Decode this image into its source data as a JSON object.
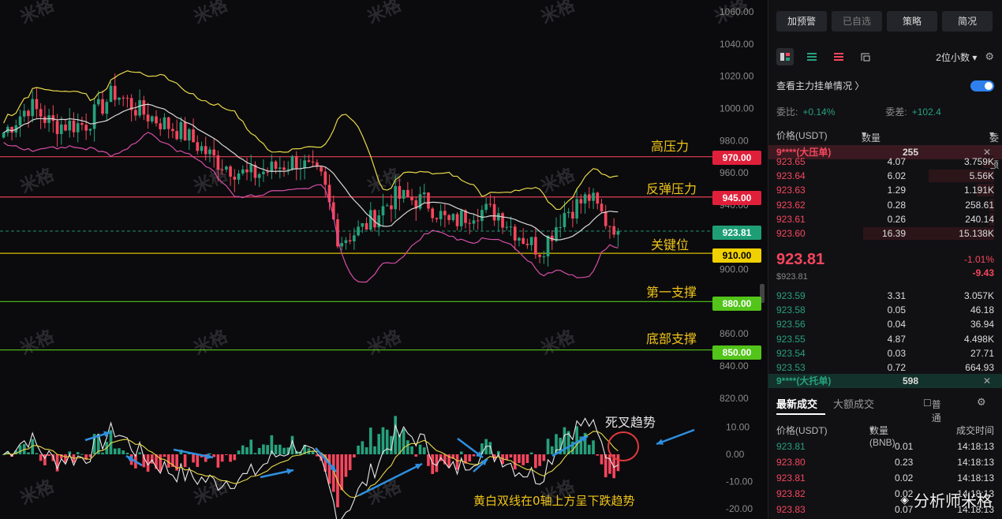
{
  "chart_data": [
    {
      "type": "candlestick",
      "pair": "BNB/USDT",
      "y_axis": {
        "ticks": [
          1060,
          1040,
          1020,
          1000,
          980,
          960,
          940,
          900,
          860,
          840,
          820
        ],
        "range": [
          820,
          1065
        ]
      },
      "current_price": 923.81,
      "overlays": [
        "bollinger-upper",
        "bollinger-middle",
        "bollinger-lower"
      ],
      "levels": [
        {
          "price": 970,
          "label": "970.00",
          "annotation": "高压力",
          "color": "#f6465d"
        },
        {
          "price": 945,
          "label": "945.00",
          "annotation": "反弹压力",
          "color": "#f6465d"
        },
        {
          "price": 923.81,
          "label": "923.81",
          "annotation": "关键位",
          "color": "#26a17b"
        },
        {
          "price": 910,
          "label": "910.00",
          "annotation": "",
          "color": "#f0d000"
        },
        {
          "price": 880,
          "label": "880.00",
          "annotation": "第一支撑",
          "color": "#52c41a"
        },
        {
          "price": 850,
          "label": "850.00",
          "annotation": "底部支撑",
          "color": "#52c41a"
        }
      ]
    },
    {
      "type": "macd",
      "y_axis": {
        "ticks": [
          10.0,
          0.0,
          -10.0,
          -20.0
        ],
        "labels": [
          "10.00",
          "0.00",
          "-10.00",
          "-20.00"
        ],
        "range": [
          -22,
          13
        ]
      },
      "annotations": [
        "死叉趋势",
        "黄白双线在0轴上方呈下跌趋势"
      ]
    }
  ],
  "watermark_text": "米格",
  "brand": "分析师米格",
  "panel": {
    "buttons": [
      "加预警",
      "已自选",
      "策略",
      "简况"
    ],
    "decimal_select": "2位小数",
    "main_orders_label": "查看主力挂单情况",
    "ratio_label": "委比:",
    "ratio_value": "+0.14%",
    "diff_label": "委差:",
    "diff_value": "+102.4",
    "col_price": "价格(USDT)",
    "col_qty": "数量 (BNB)",
    "col_total": "委托额",
    "ask_wall_name": "9****(大压单)",
    "ask_wall_qty": "255",
    "asks": [
      {
        "price": "923.65",
        "qty": "4.07",
        "total": "3.759K",
        "depth": 0.05
      },
      {
        "price": "923.64",
        "qty": "6.02",
        "total": "5.56K",
        "depth": 0.3
      },
      {
        "price": "923.63",
        "qty": "1.29",
        "total": "1.191K",
        "depth": 0.08
      },
      {
        "price": "923.62",
        "qty": "0.28",
        "total": "258.61",
        "depth": 0.02
      },
      {
        "price": "923.61",
        "qty": "0.26",
        "total": "240.14",
        "depth": 0.02
      },
      {
        "price": "923.60",
        "qty": "16.39",
        "total": "15.138K",
        "depth": 0.6
      }
    ],
    "mid_price": "923.81",
    "mid_price_usd": "$923.81",
    "mid_change_pct": "-1.01%",
    "mid_change_abs": "-9.43",
    "bids": [
      {
        "price": "923.59",
        "qty": "3.31",
        "total": "3.057K"
      },
      {
        "price": "923.58",
        "qty": "0.05",
        "total": "46.18"
      },
      {
        "price": "923.56",
        "qty": "0.04",
        "total": "36.94"
      },
      {
        "price": "923.55",
        "qty": "4.87",
        "total": "4.498K"
      },
      {
        "price": "923.54",
        "qty": "0.03",
        "total": "27.71"
      },
      {
        "price": "923.53",
        "qty": "0.72",
        "total": "664.93"
      }
    ],
    "bid_wall_name": "9****(大托单)",
    "bid_wall_qty": "598",
    "tab_latest": "最新成交",
    "tab_large": "大额成交",
    "normal_label": "普通",
    "trades_col_price": "价格(USDT)",
    "trades_col_qty": "数量(BNB)",
    "trades_col_time": "成交时间",
    "trades": [
      {
        "price": "923.81",
        "qty": "0.01",
        "time": "14:18:13",
        "side": "buy"
      },
      {
        "price": "923.80",
        "qty": "0.23",
        "time": "14:18:13",
        "side": "sell"
      },
      {
        "price": "923.81",
        "qty": "0.02",
        "time": "14:18:13",
        "side": "sell"
      },
      {
        "price": "923.82",
        "qty": "0.02",
        "time": "14:18:13",
        "side": "sell"
      },
      {
        "price": "923.83",
        "qty": "0.07",
        "time": "14:18:13",
        "side": "sell"
      }
    ]
  }
}
